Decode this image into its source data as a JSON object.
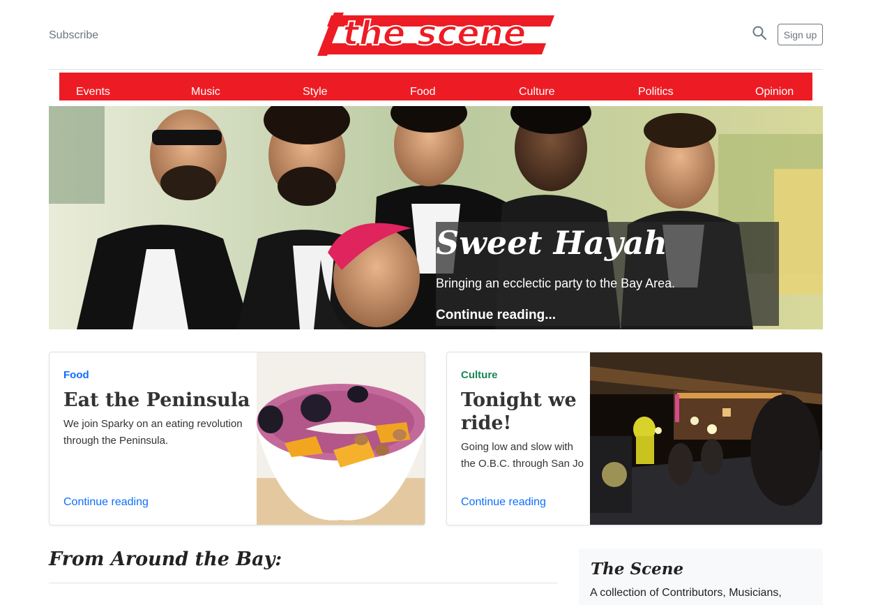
{
  "header": {
    "subscribe_label": "Subscribe",
    "logo_text": "the scene",
    "signup_label": "Sign up"
  },
  "nav": {
    "items": [
      "Events",
      "Music",
      "Style",
      "Food",
      "Culture",
      "Politics",
      "Opinion"
    ]
  },
  "hero": {
    "title": "Sweet Hayah",
    "subtitle": "Bringing an ecclectic party to the Bay Area.",
    "link": "Continue reading..."
  },
  "cards": [
    {
      "category": "Food",
      "category_color": "#0d6efd",
      "title": "Eat the Peninsula",
      "description": "We join Sparky on an eating revolution through the Peninsula.",
      "link": "Continue reading"
    },
    {
      "category": "Culture",
      "category_color": "#198754",
      "title": "Tonight we ride!",
      "description": "Going low and slow with the O.B.C. through San Jo",
      "link": "Continue reading"
    }
  ],
  "section": {
    "title": "From Around the Bay:"
  },
  "aside": {
    "title": "The Scene",
    "text": "A collection of Contributors, Musicians,"
  },
  "colors": {
    "brand_red": "#ed1c24",
    "link_blue": "#0d6efd"
  }
}
